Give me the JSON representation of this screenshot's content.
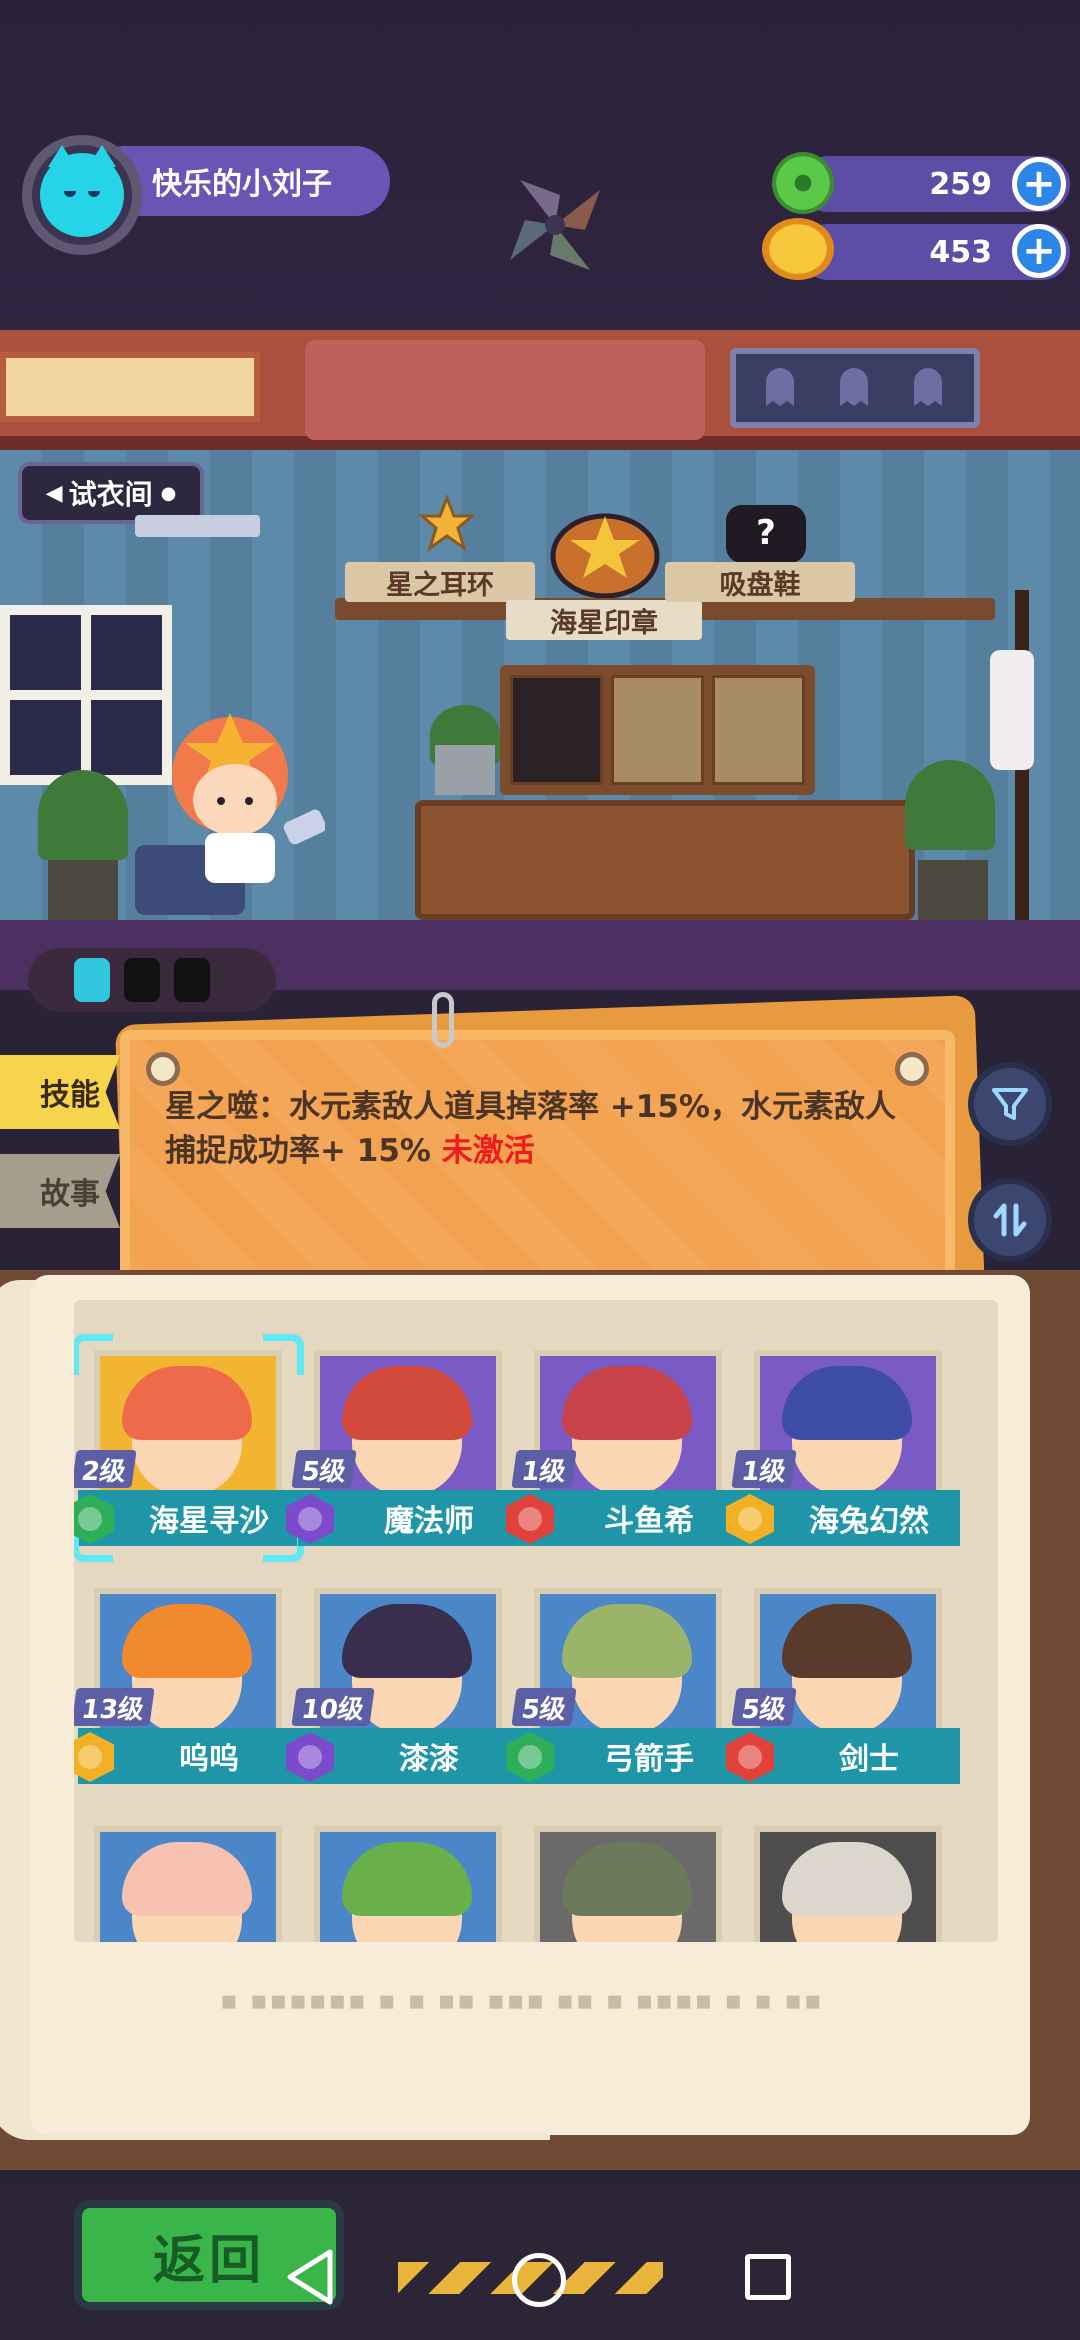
{
  "player": {
    "name": "快乐的小刘子"
  },
  "currency": [
    {
      "icon": "green-gem-icon",
      "amount": "259",
      "color": "#5cc84a"
    },
    {
      "icon": "gold-coin-icon",
      "amount": "453",
      "color": "#f5b72c"
    }
  ],
  "room": {
    "fitting_room_label": "试衣间",
    "shelf_items": [
      {
        "label": "星之耳环",
        "icon": "star-earring-icon"
      },
      {
        "label": "海星印章",
        "icon": "starfish-seal-icon"
      },
      {
        "label": "吸盘鞋",
        "icon": "unknown-item-icon"
      }
    ]
  },
  "tabs": {
    "skill": "技能",
    "story": "故事"
  },
  "skill": {
    "description": "星之噬：水元素敌人道具掉落率 +15%，水元素敌人捕捉成功率+ 15%",
    "status": "未激活"
  },
  "characters": [
    {
      "level": "2级",
      "name": "海星寻沙",
      "element": "green",
      "bg": "#f2b531",
      "hair": "#ef6a4a",
      "selected": true
    },
    {
      "level": "5级",
      "name": "魔法师",
      "element": "purple",
      "bg": "#7a5ac4",
      "hair": "#d24a3c",
      "selected": false
    },
    {
      "level": "1级",
      "name": "斗鱼希",
      "element": "red",
      "bg": "#7a5ac4",
      "hair": "#c8444a",
      "selected": false
    },
    {
      "level": "1级",
      "name": "海兔幻然",
      "element": "gold",
      "bg": "#7a5ac4",
      "hair": "#3e4ea8",
      "selected": false
    },
    {
      "level": "13级",
      "name": "呜呜",
      "element": "gold",
      "bg": "#4a86c8",
      "hair": "#f08a2c",
      "selected": false
    },
    {
      "level": "10级",
      "name": "漆漆",
      "element": "purple",
      "bg": "#4a86c8",
      "hair": "#3a2e4e",
      "selected": false
    },
    {
      "level": "5级",
      "name": "弓箭手",
      "element": "green",
      "bg": "#4a86c8",
      "hair": "#9ab56a",
      "selected": false
    },
    {
      "level": "5级",
      "name": "剑士",
      "element": "red",
      "bg": "#4a86c8",
      "hair": "#5a3a2a",
      "selected": false
    },
    {
      "bg": "#4a86c8",
      "hair": "#f7c2b0"
    },
    {
      "bg": "#4a86c8",
      "hair": "#6ab04a"
    },
    {
      "bg": "#6a6a6a",
      "hair": "#6a7a5a"
    },
    {
      "bg": "#4e4e4e",
      "hair": "#ddd6cc"
    }
  ],
  "element_colors": {
    "green": "#2fae5a",
    "purple": "#7b4bcc",
    "red": "#e0413a",
    "gold": "#f2b124"
  },
  "buttons": {
    "back": "返回"
  }
}
